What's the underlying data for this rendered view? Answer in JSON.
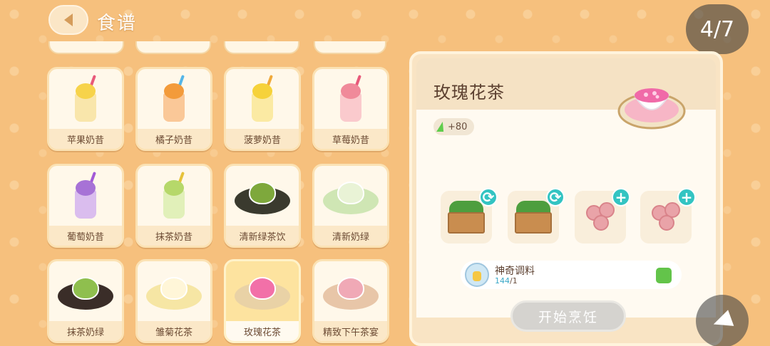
{
  "header": {
    "title": "食谱",
    "page_indicator": "4/7"
  },
  "recipes": [
    {
      "label": "苹果奶昔",
      "icon": "apple-milkshake-icon"
    },
    {
      "label": "橘子奶昔",
      "icon": "orange-milkshake-icon"
    },
    {
      "label": "菠萝奶昔",
      "icon": "pineapple-milkshake-icon"
    },
    {
      "label": "草莓奶昔",
      "icon": "strawberry-milkshake-icon"
    },
    {
      "label": "葡萄奶昔",
      "icon": "grape-milkshake-icon"
    },
    {
      "label": "抹茶奶昔",
      "icon": "matcha-milkshake-icon"
    },
    {
      "label": "清新绿茶饮",
      "icon": "green-tea-icon"
    },
    {
      "label": "清新奶绿",
      "icon": "milk-green-tea-icon"
    },
    {
      "label": "抹茶奶绿",
      "icon": "matcha-milk-green-icon"
    },
    {
      "label": "雏菊花茶",
      "icon": "daisy-tea-icon"
    },
    {
      "label": "玫瑰花茶",
      "icon": "rose-tea-icon",
      "selected": true
    },
    {
      "label": "精致下午茶宴",
      "icon": "afternoon-tea-icon"
    }
  ],
  "detail": {
    "name": "玫瑰花茶",
    "energy": "+80",
    "ingredients": [
      {
        "icon": "tea-leaves-crate-icon",
        "badge": "swap-icon"
      },
      {
        "icon": "tea-leaves-crate-icon",
        "badge": "swap-icon"
      },
      {
        "icon": "rose-icon",
        "badge": "plus-icon"
      },
      {
        "icon": "rose-icon",
        "badge": "plus-icon"
      }
    ],
    "special": {
      "name": "神奇调料",
      "have": "144",
      "need": "/1",
      "checked": true
    },
    "cook_button": "开始烹饪"
  },
  "colors": {
    "background": "#f6c07d",
    "accent_teal": "#33c4c2",
    "check_green": "#63c44a"
  }
}
